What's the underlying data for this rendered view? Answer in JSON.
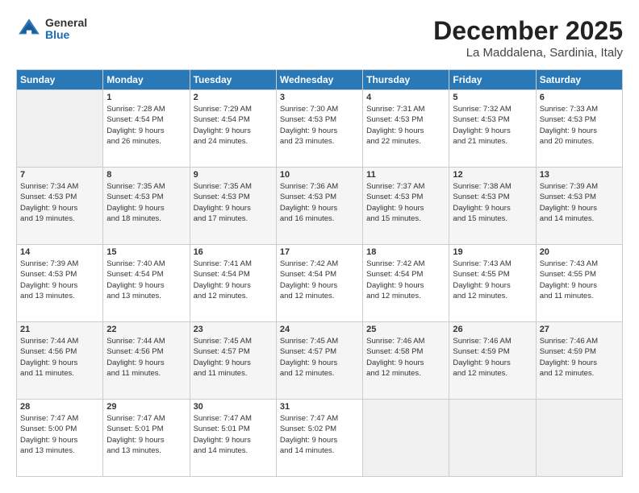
{
  "logo": {
    "general": "General",
    "blue": "Blue"
  },
  "title": "December 2025",
  "subtitle": "La Maddalena, Sardinia, Italy",
  "headers": [
    "Sunday",
    "Monday",
    "Tuesday",
    "Wednesday",
    "Thursday",
    "Friday",
    "Saturday"
  ],
  "weeks": [
    [
      {
        "day": "",
        "info": ""
      },
      {
        "day": "1",
        "info": "Sunrise: 7:28 AM\nSunset: 4:54 PM\nDaylight: 9 hours\nand 26 minutes."
      },
      {
        "day": "2",
        "info": "Sunrise: 7:29 AM\nSunset: 4:54 PM\nDaylight: 9 hours\nand 24 minutes."
      },
      {
        "day": "3",
        "info": "Sunrise: 7:30 AM\nSunset: 4:53 PM\nDaylight: 9 hours\nand 23 minutes."
      },
      {
        "day": "4",
        "info": "Sunrise: 7:31 AM\nSunset: 4:53 PM\nDaylight: 9 hours\nand 22 minutes."
      },
      {
        "day": "5",
        "info": "Sunrise: 7:32 AM\nSunset: 4:53 PM\nDaylight: 9 hours\nand 21 minutes."
      },
      {
        "day": "6",
        "info": "Sunrise: 7:33 AM\nSunset: 4:53 PM\nDaylight: 9 hours\nand 20 minutes."
      }
    ],
    [
      {
        "day": "7",
        "info": "Sunrise: 7:34 AM\nSunset: 4:53 PM\nDaylight: 9 hours\nand 19 minutes."
      },
      {
        "day": "8",
        "info": "Sunrise: 7:35 AM\nSunset: 4:53 PM\nDaylight: 9 hours\nand 18 minutes."
      },
      {
        "day": "9",
        "info": "Sunrise: 7:35 AM\nSunset: 4:53 PM\nDaylight: 9 hours\nand 17 minutes."
      },
      {
        "day": "10",
        "info": "Sunrise: 7:36 AM\nSunset: 4:53 PM\nDaylight: 9 hours\nand 16 minutes."
      },
      {
        "day": "11",
        "info": "Sunrise: 7:37 AM\nSunset: 4:53 PM\nDaylight: 9 hours\nand 15 minutes."
      },
      {
        "day": "12",
        "info": "Sunrise: 7:38 AM\nSunset: 4:53 PM\nDaylight: 9 hours\nand 15 minutes."
      },
      {
        "day": "13",
        "info": "Sunrise: 7:39 AM\nSunset: 4:53 PM\nDaylight: 9 hours\nand 14 minutes."
      }
    ],
    [
      {
        "day": "14",
        "info": "Sunrise: 7:39 AM\nSunset: 4:53 PM\nDaylight: 9 hours\nand 13 minutes."
      },
      {
        "day": "15",
        "info": "Sunrise: 7:40 AM\nSunset: 4:54 PM\nDaylight: 9 hours\nand 13 minutes."
      },
      {
        "day": "16",
        "info": "Sunrise: 7:41 AM\nSunset: 4:54 PM\nDaylight: 9 hours\nand 12 minutes."
      },
      {
        "day": "17",
        "info": "Sunrise: 7:42 AM\nSunset: 4:54 PM\nDaylight: 9 hours\nand 12 minutes."
      },
      {
        "day": "18",
        "info": "Sunrise: 7:42 AM\nSunset: 4:54 PM\nDaylight: 9 hours\nand 12 minutes."
      },
      {
        "day": "19",
        "info": "Sunrise: 7:43 AM\nSunset: 4:55 PM\nDaylight: 9 hours\nand 12 minutes."
      },
      {
        "day": "20",
        "info": "Sunrise: 7:43 AM\nSunset: 4:55 PM\nDaylight: 9 hours\nand 11 minutes."
      }
    ],
    [
      {
        "day": "21",
        "info": "Sunrise: 7:44 AM\nSunset: 4:56 PM\nDaylight: 9 hours\nand 11 minutes."
      },
      {
        "day": "22",
        "info": "Sunrise: 7:44 AM\nSunset: 4:56 PM\nDaylight: 9 hours\nand 11 minutes."
      },
      {
        "day": "23",
        "info": "Sunrise: 7:45 AM\nSunset: 4:57 PM\nDaylight: 9 hours\nand 11 minutes."
      },
      {
        "day": "24",
        "info": "Sunrise: 7:45 AM\nSunset: 4:57 PM\nDaylight: 9 hours\nand 12 minutes."
      },
      {
        "day": "25",
        "info": "Sunrise: 7:46 AM\nSunset: 4:58 PM\nDaylight: 9 hours\nand 12 minutes."
      },
      {
        "day": "26",
        "info": "Sunrise: 7:46 AM\nSunset: 4:59 PM\nDaylight: 9 hours\nand 12 minutes."
      },
      {
        "day": "27",
        "info": "Sunrise: 7:46 AM\nSunset: 4:59 PM\nDaylight: 9 hours\nand 12 minutes."
      }
    ],
    [
      {
        "day": "28",
        "info": "Sunrise: 7:47 AM\nSunset: 5:00 PM\nDaylight: 9 hours\nand 13 minutes."
      },
      {
        "day": "29",
        "info": "Sunrise: 7:47 AM\nSunset: 5:01 PM\nDaylight: 9 hours\nand 13 minutes."
      },
      {
        "day": "30",
        "info": "Sunrise: 7:47 AM\nSunset: 5:01 PM\nDaylight: 9 hours\nand 14 minutes."
      },
      {
        "day": "31",
        "info": "Sunrise: 7:47 AM\nSunset: 5:02 PM\nDaylight: 9 hours\nand 14 minutes."
      },
      {
        "day": "",
        "info": ""
      },
      {
        "day": "",
        "info": ""
      },
      {
        "day": "",
        "info": ""
      }
    ]
  ]
}
